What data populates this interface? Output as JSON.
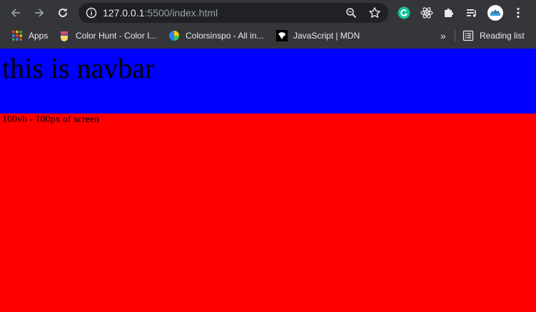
{
  "browser": {
    "url_host": "127.0.0.1",
    "url_rest": ":5500/index.html",
    "icons": {
      "back": "arrow-left-icon",
      "forward": "arrow-right-icon",
      "reload": "reload-icon",
      "info": "info-icon",
      "zoom": "zoom-icon",
      "star": "star-icon",
      "grammarly": "grammarly-icon",
      "react": "react-devtools-icon",
      "extensions": "puzzle-icon",
      "media": "media-queue-icon",
      "profile": "profile-avatar",
      "menu": "kebab-menu-icon"
    }
  },
  "bookmarks": {
    "items": [
      {
        "label": "Apps",
        "icon": "apps-grid-icon"
      },
      {
        "label": "Color Hunt - Color I...",
        "icon": "colorhunt-icon"
      },
      {
        "label": "Colorsinspo - All in...",
        "icon": "colorsinspo-icon"
      },
      {
        "label": "JavaScript | MDN",
        "icon": "mdn-icon"
      }
    ],
    "overflow_label": "»",
    "reading_list_label": "Reading list"
  },
  "page": {
    "navbar_text": "this is navbar",
    "content_text": "100vh - 100px of screen",
    "colors": {
      "navbar_bg": "#0000ff",
      "content_bg": "#ff0000"
    }
  }
}
